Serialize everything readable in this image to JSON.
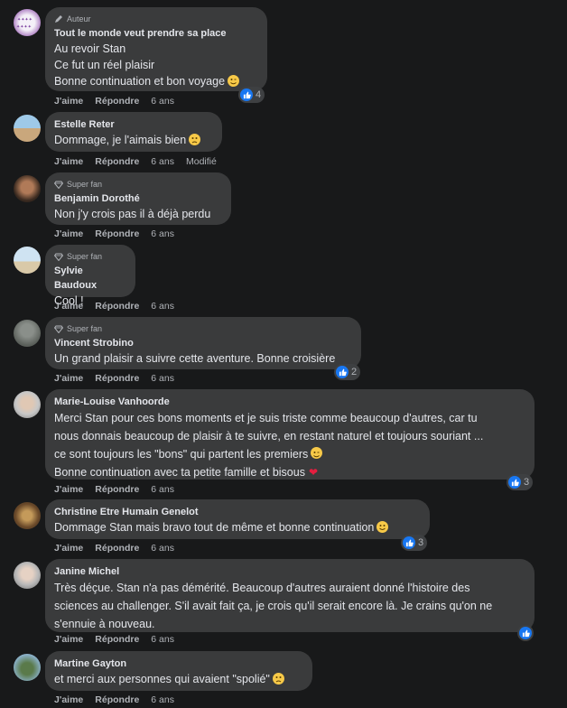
{
  "comments": [
    {
      "badge": "Auteur",
      "author": "Tout le monde veut prendre sa place",
      "lines": [
        "Au revoir Stan",
        "Ce fut un réel plaisir",
        "Bonne continuation et bon voyage"
      ],
      "reaction_count": "4",
      "like": "J'aime",
      "reply": "Répondre",
      "time": "6 ans"
    },
    {
      "author": "Estelle Reter",
      "lines": [
        "Dommage, je l'aimais bien"
      ],
      "like": "J'aime",
      "reply": "Répondre",
      "time": "6 ans",
      "edited": "Modifié"
    },
    {
      "badge": "Super fan",
      "author": "Benjamin Dorothé",
      "lines": [
        "Non j'y crois pas il à déjà perdu"
      ],
      "like": "J'aime",
      "reply": "Répondre",
      "time": "6 ans"
    },
    {
      "badge": "Super fan",
      "author": "Sylvie Baudoux",
      "lines": [
        "Cool !"
      ],
      "like": "J'aime",
      "reply": "Répondre",
      "time": "6 ans"
    },
    {
      "badge": "Super fan",
      "author": "Vincent Strobino",
      "lines": [
        "Un grand plaisir a suivre cette aventure. Bonne croisière"
      ],
      "reaction_count": "2",
      "like": "J'aime",
      "reply": "Répondre",
      "time": "6 ans"
    },
    {
      "author": "Marie-Louise Vanhoorde",
      "lines": [
        "Merci Stan pour ces bons moments et je suis triste comme beaucoup d'autres, car tu",
        "nous donnais beaucoup de plaisir à te suivre, en restant naturel et toujours souriant ...",
        "ce sont toujours les \"bons\" qui partent les premiers",
        "Bonne continuation avec ta petite famille et bisous"
      ],
      "reaction_count": "3",
      "like": "J'aime",
      "reply": "Répondre",
      "time": "6 ans"
    },
    {
      "author": "Christine Etre Humain Genelot",
      "lines": [
        "Dommage Stan mais bravo tout de même et bonne continuation"
      ],
      "reaction_count": "3",
      "like": "J'aime",
      "reply": "Répondre",
      "time": "6 ans"
    },
    {
      "author": "Janine Michel",
      "lines": [
        "Très déçue. Stan n'a pas démérité. Beaucoup d'autres auraient donné l'histoire des",
        "sciences au challenger. S'il avait fait ça, je crois qu'il serait encore là. Je crains qu'on ne",
        "s'ennuie à nouveau."
      ],
      "like": "J'aime",
      "reply": "Répondre",
      "time": "6 ans"
    },
    {
      "author": "Martine Gayton",
      "lines": [
        "et merci aux personnes qui avaient \"spolié\""
      ],
      "like": "J'aime",
      "reply": "Répondre",
      "time": "6 ans"
    }
  ],
  "colors": {
    "background": "#18191a",
    "bubble": "#3a3b3c",
    "like_blue": "#1877f2",
    "secondary_text": "#b0b3b8"
  }
}
